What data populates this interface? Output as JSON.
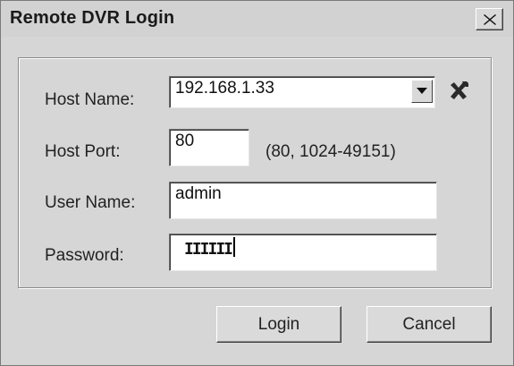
{
  "window": {
    "title": "Remote DVR Login"
  },
  "form": {
    "host_name_label": "Host Name:",
    "host_name_value": "192.168.1.33",
    "host_port_label": "Host Port:",
    "host_port_value": "80",
    "host_port_hint": "(80, 1024-49151)",
    "user_name_label": "User Name:",
    "user_name_value": "admin",
    "password_label": "Password:",
    "password_masked": "IIIIII"
  },
  "buttons": {
    "login": "Login",
    "cancel": "Cancel"
  },
  "icons": {
    "close": "close-icon",
    "dropdown": "chevron-down-icon",
    "host_tools": "tools-icon"
  }
}
